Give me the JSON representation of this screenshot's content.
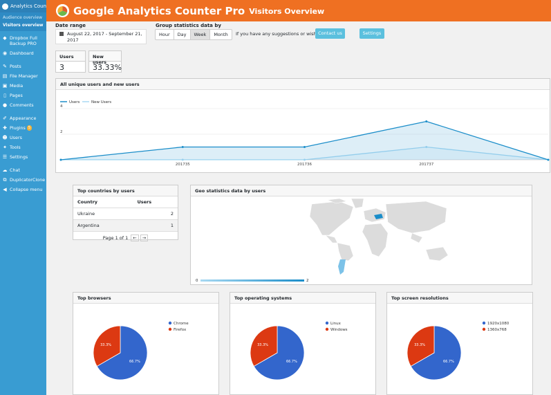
{
  "sidebar": {
    "top_label": "Analytics Counter",
    "sub_items": [
      "Audience overview",
      "Visitors overview"
    ],
    "items": [
      {
        "label": "Dropbox Full Backup PRO",
        "icon": "dropbox-icon"
      },
      {
        "label": "Dashboard",
        "icon": "dashboard-icon"
      },
      {
        "label": "Posts",
        "icon": "pin-icon"
      },
      {
        "label": "File Manager",
        "icon": "folder-icon"
      },
      {
        "label": "Media",
        "icon": "media-icon"
      },
      {
        "label": "Pages",
        "icon": "page-icon"
      },
      {
        "label": "Comments",
        "icon": "comment-icon"
      },
      {
        "label": "Appearance",
        "icon": "brush-icon"
      },
      {
        "label": "Plugins",
        "icon": "plugin-icon",
        "badge": "5"
      },
      {
        "label": "Users",
        "icon": "user-icon"
      },
      {
        "label": "Tools",
        "icon": "wrench-icon"
      },
      {
        "label": "Settings",
        "icon": "settings-icon"
      },
      {
        "label": "Chat",
        "icon": "chat-icon"
      },
      {
        "label": "DuplicatorClone",
        "icon": "clone-icon"
      },
      {
        "label": "Collapse menu",
        "icon": "collapse-icon"
      }
    ]
  },
  "header": {
    "title": "Google Analytics Counter Pro",
    "subtitle": "Visitors Overview",
    "color": "#ef7022"
  },
  "controls": {
    "date_label": "Date range",
    "date_value": "August 22, 2017 - September 21, 2017",
    "group_label": "Group statistics data by",
    "group_options": [
      "Hour",
      "Day",
      "Week",
      "Month"
    ],
    "group_selected": "Week",
    "suggest_text": "If you have any suggestions or wishes",
    "contact_label": "Contact us",
    "settings_label": "Settings"
  },
  "stats": {
    "users_label": "Users",
    "users_value": "3",
    "new_users_label": "New users",
    "new_users_value": "33.33%"
  },
  "line_panel": {
    "title": "All unique users and new users"
  },
  "chart_data": [
    {
      "type": "area",
      "title": "All unique users and new users",
      "x": [
        "",
        "201735",
        "201736",
        "201737",
        ""
      ],
      "ytick_labels": [
        "4",
        "2"
      ],
      "ylim": [
        0,
        4
      ],
      "series": [
        {
          "name": "Users",
          "values": [
            0,
            1,
            1,
            3,
            0
          ],
          "color": "#1a8dc9"
        },
        {
          "name": "New Users",
          "values": [
            0,
            0,
            0,
            1,
            0
          ],
          "color": "#a8d9f2"
        }
      ],
      "legend": "top-left"
    },
    {
      "type": "pie",
      "title": "Top browsers",
      "categories": [
        "Chrome",
        "Firefox"
      ],
      "values": [
        66.7,
        33.3
      ],
      "labels": [
        "66.7%",
        "33.3%"
      ],
      "colors": [
        "#3366cc",
        "#dc3912"
      ]
    },
    {
      "type": "pie",
      "title": "Top operating systems",
      "categories": [
        "Linux",
        "Windows"
      ],
      "values": [
        66.7,
        33.3
      ],
      "labels": [
        "66.7%",
        "33.3%"
      ],
      "colors": [
        "#3366cc",
        "#dc3912"
      ]
    },
    {
      "type": "pie",
      "title": "Top screen resolutions",
      "categories": [
        "1920x1080",
        "1360x768"
      ],
      "values": [
        66.7,
        33.3
      ],
      "labels": [
        "66.7%",
        "33.3%"
      ],
      "colors": [
        "#3366cc",
        "#dc3912"
      ]
    }
  ],
  "countries": {
    "title": "Top countries by users",
    "col_country": "Country",
    "col_users": "Users",
    "rows": [
      {
        "country": "Ukraine",
        "users": "2"
      },
      {
        "country": "Argentina",
        "users": "1"
      }
    ],
    "pager": "Page 1 of 1",
    "prev_icon": "←",
    "next_icon": "→"
  },
  "geo": {
    "title": "Geo statistics data by users",
    "scale_min": "0",
    "scale_max": "2"
  }
}
